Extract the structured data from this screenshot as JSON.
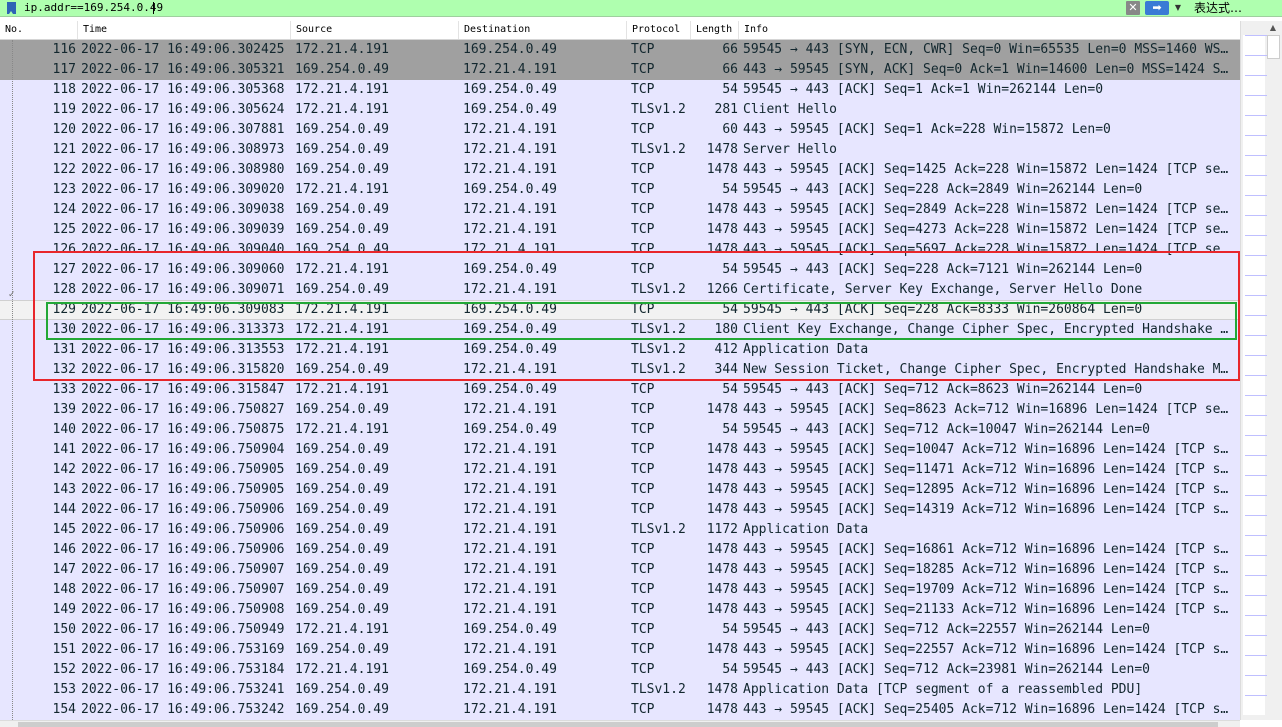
{
  "filter": {
    "value": "ip.addr==169.254.0.49",
    "clear_glyph": "✕",
    "apply_glyph": "➡",
    "dropdown_glyph": "▼",
    "expression_label": "表达式…",
    "bar_color": "#afffaf"
  },
  "columns": {
    "no": "No.",
    "time": "Time",
    "source": "Source",
    "destination": "Destination",
    "protocol": "Protocol",
    "length": "Length",
    "info": "Info"
  },
  "colors": {
    "row_background": "#e7e6ff",
    "dark_row_background": "#a0a0a0",
    "red_box": "#e8262b",
    "green_box": "#23a836"
  },
  "packets": [
    {
      "no": "116",
      "time": "2022-06-17 16:49:06.302425",
      "src": "172.21.4.191",
      "dst": "169.254.0.49",
      "proto": "TCP",
      "len": "66",
      "info": "59545 → 443 [SYN, ECN, CWR] Seq=0 Win=65535 Len=0 MSS=1460 WS…",
      "style": "dark"
    },
    {
      "no": "117",
      "time": "2022-06-17 16:49:06.305321",
      "src": "169.254.0.49",
      "dst": "172.21.4.191",
      "proto": "TCP",
      "len": "66",
      "info": "443 → 59545 [SYN, ACK] Seq=0 Ack=1 Win=14600 Len=0 MSS=1424 S…",
      "style": "dark"
    },
    {
      "no": "118",
      "time": "2022-06-17 16:49:06.305368",
      "src": "172.21.4.191",
      "dst": "169.254.0.49",
      "proto": "TCP",
      "len": "54",
      "info": "59545 → 443 [ACK] Seq=1 Ack=1 Win=262144 Len=0",
      "style": "normal"
    },
    {
      "no": "119",
      "time": "2022-06-17 16:49:06.305624",
      "src": "172.21.4.191",
      "dst": "169.254.0.49",
      "proto": "TLSv1.2",
      "len": "281",
      "info": "Client Hello",
      "style": "normal"
    },
    {
      "no": "120",
      "time": "2022-06-17 16:49:06.307881",
      "src": "169.254.0.49",
      "dst": "172.21.4.191",
      "proto": "TCP",
      "len": "60",
      "info": "443 → 59545 [ACK] Seq=1 Ack=228 Win=15872 Len=0",
      "style": "normal"
    },
    {
      "no": "121",
      "time": "2022-06-17 16:49:06.308973",
      "src": "169.254.0.49",
      "dst": "172.21.4.191",
      "proto": "TLSv1.2",
      "len": "1478",
      "info": "Server Hello",
      "style": "normal"
    },
    {
      "no": "122",
      "time": "2022-06-17 16:49:06.308980",
      "src": "169.254.0.49",
      "dst": "172.21.4.191",
      "proto": "TCP",
      "len": "1478",
      "info": "443 → 59545 [ACK] Seq=1425 Ack=228 Win=15872 Len=1424 [TCP se…",
      "style": "normal"
    },
    {
      "no": "123",
      "time": "2022-06-17 16:49:06.309020",
      "src": "172.21.4.191",
      "dst": "169.254.0.49",
      "proto": "TCP",
      "len": "54",
      "info": "59545 → 443 [ACK] Seq=228 Ack=2849 Win=262144 Len=0",
      "style": "normal"
    },
    {
      "no": "124",
      "time": "2022-06-17 16:49:06.309038",
      "src": "169.254.0.49",
      "dst": "172.21.4.191",
      "proto": "TCP",
      "len": "1478",
      "info": "443 → 59545 [ACK] Seq=2849 Ack=228 Win=15872 Len=1424 [TCP se…",
      "style": "normal"
    },
    {
      "no": "125",
      "time": "2022-06-17 16:49:06.309039",
      "src": "169.254.0.49",
      "dst": "172.21.4.191",
      "proto": "TCP",
      "len": "1478",
      "info": "443 → 59545 [ACK] Seq=4273 Ack=228 Win=15872 Len=1424 [TCP se…",
      "style": "normal"
    },
    {
      "no": "126",
      "time": "2022-06-17 16:49:06.309040",
      "src": "169.254.0.49",
      "dst": "172.21.4.191",
      "proto": "TCP",
      "len": "1478",
      "info": "443 → 59545 [ACK] Seq=5697 Ack=228 Win=15872 Len=1424 [TCP se…",
      "style": "normal"
    },
    {
      "no": "127",
      "time": "2022-06-17 16:49:06.309060",
      "src": "172.21.4.191",
      "dst": "169.254.0.49",
      "proto": "TCP",
      "len": "54",
      "info": "59545 → 443 [ACK] Seq=228 Ack=7121 Win=262144 Len=0",
      "style": "normal"
    },
    {
      "no": "128",
      "time": "2022-06-17 16:49:06.309071",
      "src": "169.254.0.49",
      "dst": "172.21.4.191",
      "proto": "TLSv1.2",
      "len": "1266",
      "info": "Certificate, Server Key Exchange, Server Hello Done",
      "style": "normal"
    },
    {
      "no": "129",
      "time": "2022-06-17 16:49:06.309083",
      "src": "172.21.4.191",
      "dst": "169.254.0.49",
      "proto": "TCP",
      "len": "54",
      "info": "59545 → 443 [ACK] Seq=228 Ack=8333 Win=260864 Len=0",
      "style": "selected"
    },
    {
      "no": "130",
      "time": "2022-06-17 16:49:06.313373",
      "src": "172.21.4.191",
      "dst": "169.254.0.49",
      "proto": "TLSv1.2",
      "len": "180",
      "info": "Client Key Exchange, Change Cipher Spec, Encrypted Handshake …",
      "style": "normal"
    },
    {
      "no": "131",
      "time": "2022-06-17 16:49:06.313553",
      "src": "172.21.4.191",
      "dst": "169.254.0.49",
      "proto": "TLSv1.2",
      "len": "412",
      "info": "Application Data",
      "style": "normal"
    },
    {
      "no": "132",
      "time": "2022-06-17 16:49:06.315820",
      "src": "169.254.0.49",
      "dst": "172.21.4.191",
      "proto": "TLSv1.2",
      "len": "344",
      "info": "New Session Ticket, Change Cipher Spec, Encrypted Handshake M…",
      "style": "normal"
    },
    {
      "no": "133",
      "time": "2022-06-17 16:49:06.315847",
      "src": "172.21.4.191",
      "dst": "169.254.0.49",
      "proto": "TCP",
      "len": "54",
      "info": "59545 → 443 [ACK] Seq=712 Ack=8623 Win=262144 Len=0",
      "style": "normal"
    },
    {
      "no": "139",
      "time": "2022-06-17 16:49:06.750827",
      "src": "169.254.0.49",
      "dst": "172.21.4.191",
      "proto": "TCP",
      "len": "1478",
      "info": "443 → 59545 [ACK] Seq=8623 Ack=712 Win=16896 Len=1424 [TCP se…",
      "style": "normal"
    },
    {
      "no": "140",
      "time": "2022-06-17 16:49:06.750875",
      "src": "172.21.4.191",
      "dst": "169.254.0.49",
      "proto": "TCP",
      "len": "54",
      "info": "59545 → 443 [ACK] Seq=712 Ack=10047 Win=262144 Len=0",
      "style": "normal"
    },
    {
      "no": "141",
      "time": "2022-06-17 16:49:06.750904",
      "src": "169.254.0.49",
      "dst": "172.21.4.191",
      "proto": "TCP",
      "len": "1478",
      "info": "443 → 59545 [ACK] Seq=10047 Ack=712 Win=16896 Len=1424 [TCP s…",
      "style": "normal"
    },
    {
      "no": "142",
      "time": "2022-06-17 16:49:06.750905",
      "src": "169.254.0.49",
      "dst": "172.21.4.191",
      "proto": "TCP",
      "len": "1478",
      "info": "443 → 59545 [ACK] Seq=11471 Ack=712 Win=16896 Len=1424 [TCP s…",
      "style": "normal"
    },
    {
      "no": "143",
      "time": "2022-06-17 16:49:06.750905",
      "src": "169.254.0.49",
      "dst": "172.21.4.191",
      "proto": "TCP",
      "len": "1478",
      "info": "443 → 59545 [ACK] Seq=12895 Ack=712 Win=16896 Len=1424 [TCP s…",
      "style": "normal"
    },
    {
      "no": "144",
      "time": "2022-06-17 16:49:06.750906",
      "src": "169.254.0.49",
      "dst": "172.21.4.191",
      "proto": "TCP",
      "len": "1478",
      "info": "443 → 59545 [ACK] Seq=14319 Ack=712 Win=16896 Len=1424 [TCP s…",
      "style": "normal"
    },
    {
      "no": "145",
      "time": "2022-06-17 16:49:06.750906",
      "src": "169.254.0.49",
      "dst": "172.21.4.191",
      "proto": "TLSv1.2",
      "len": "1172",
      "info": "Application Data",
      "style": "normal"
    },
    {
      "no": "146",
      "time": "2022-06-17 16:49:06.750906",
      "src": "169.254.0.49",
      "dst": "172.21.4.191",
      "proto": "TCP",
      "len": "1478",
      "info": "443 → 59545 [ACK] Seq=16861 Ack=712 Win=16896 Len=1424 [TCP s…",
      "style": "normal"
    },
    {
      "no": "147",
      "time": "2022-06-17 16:49:06.750907",
      "src": "169.254.0.49",
      "dst": "172.21.4.191",
      "proto": "TCP",
      "len": "1478",
      "info": "443 → 59545 [ACK] Seq=18285 Ack=712 Win=16896 Len=1424 [TCP s…",
      "style": "normal"
    },
    {
      "no": "148",
      "time": "2022-06-17 16:49:06.750907",
      "src": "169.254.0.49",
      "dst": "172.21.4.191",
      "proto": "TCP",
      "len": "1478",
      "info": "443 → 59545 [ACK] Seq=19709 Ack=712 Win=16896 Len=1424 [TCP s…",
      "style": "normal"
    },
    {
      "no": "149",
      "time": "2022-06-17 16:49:06.750908",
      "src": "169.254.0.49",
      "dst": "172.21.4.191",
      "proto": "TCP",
      "len": "1478",
      "info": "443 → 59545 [ACK] Seq=21133 Ack=712 Win=16896 Len=1424 [TCP s…",
      "style": "normal"
    },
    {
      "no": "150",
      "time": "2022-06-17 16:49:06.750949",
      "src": "172.21.4.191",
      "dst": "169.254.0.49",
      "proto": "TCP",
      "len": "54",
      "info": "59545 → 443 [ACK] Seq=712 Ack=22557 Win=262144 Len=0",
      "style": "normal"
    },
    {
      "no": "151",
      "time": "2022-06-17 16:49:06.753169",
      "src": "169.254.0.49",
      "dst": "172.21.4.191",
      "proto": "TCP",
      "len": "1478",
      "info": "443 → 59545 [ACK] Seq=22557 Ack=712 Win=16896 Len=1424 [TCP s…",
      "style": "normal"
    },
    {
      "no": "152",
      "time": "2022-06-17 16:49:06.753184",
      "src": "172.21.4.191",
      "dst": "169.254.0.49",
      "proto": "TCP",
      "len": "54",
      "info": "59545 → 443 [ACK] Seq=712 Ack=23981 Win=262144 Len=0",
      "style": "normal"
    },
    {
      "no": "153",
      "time": "2022-06-17 16:49:06.753241",
      "src": "169.254.0.49",
      "dst": "172.21.4.191",
      "proto": "TLSv1.2",
      "len": "1478",
      "info": "Application Data [TCP segment of a reassembled PDU]",
      "style": "normal"
    },
    {
      "no": "154",
      "time": "2022-06-17 16:49:06.753242",
      "src": "169.254.0.49",
      "dst": "172.21.4.191",
      "proto": "TCP",
      "len": "1478",
      "info": "443 → 59545 [ACK] Seq=25405 Ack=712 Win=16896 Len=1424 [TCP s…",
      "style": "normal"
    }
  ]
}
